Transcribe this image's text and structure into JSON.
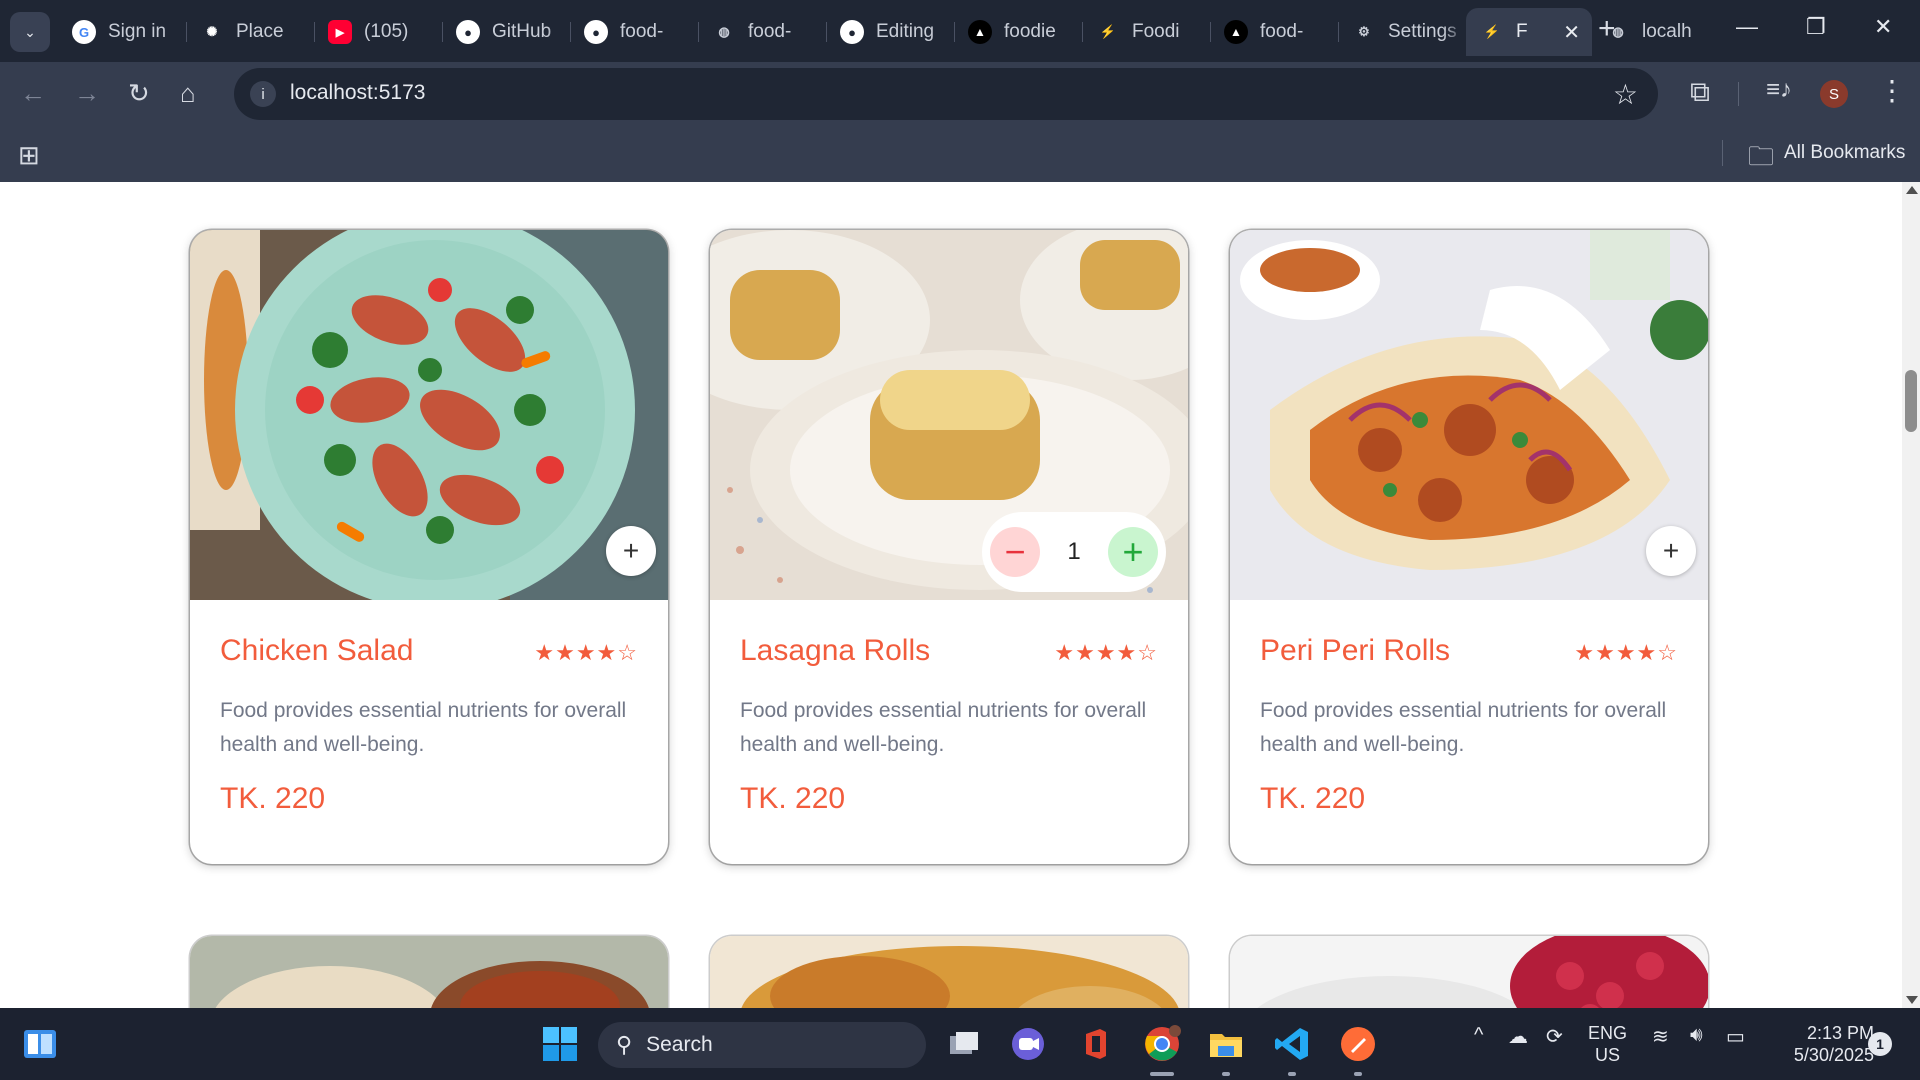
{
  "browser": {
    "tabs": [
      {
        "title": "Sign in",
        "favicon": "google-icon",
        "color": "#ffffff"
      },
      {
        "title": "Place",
        "favicon": "chatgpt-icon",
        "color": "#ffffff"
      },
      {
        "title": "(105)",
        "favicon": "youtube-icon",
        "color": "#ff0033"
      },
      {
        "title": "GitHub",
        "favicon": "github-icon",
        "color": "#ffffff"
      },
      {
        "title": "food-",
        "favicon": "github-icon",
        "color": "#ffffff"
      },
      {
        "title": "food-",
        "favicon": "globe-icon",
        "color": "#c9ced8"
      },
      {
        "title": "Editing",
        "favicon": "github-icon",
        "color": "#ffffff"
      },
      {
        "title": "foodie",
        "favicon": "vercel-icon",
        "color": "#ffffff"
      },
      {
        "title": "Foodi",
        "favicon": "vite-icon",
        "color": "#b67cff"
      },
      {
        "title": "food-",
        "favicon": "vercel-icon",
        "color": "#ffffff"
      },
      {
        "title": "Settings",
        "favicon": "gear-icon",
        "color": "#c9ced8"
      },
      {
        "title": "F",
        "favicon": "vite-icon",
        "color": "#b67cff",
        "active": true
      },
      {
        "title": "localh",
        "favicon": "globe-icon",
        "color": "#c9ced8"
      }
    ],
    "url": "localhost:5173",
    "bookmarks_label": "All Bookmarks",
    "profile_initial": "S"
  },
  "products": [
    {
      "name": "Chicken Salad",
      "rating": 4,
      "stars": "★★★★☆",
      "description": "Food provides essential nutrients for overall health and well-being.",
      "price": "TK. 220",
      "in_cart": 0
    },
    {
      "name": "Lasagna Rolls",
      "rating": 4,
      "stars": "★★★★☆",
      "description": "Food provides essential nutrients for overall health and well-being.",
      "price": "TK. 220",
      "in_cart": 1,
      "count": "1"
    },
    {
      "name": "Peri Peri Rolls",
      "rating": 4,
      "stars": "★★★★☆",
      "description": "Food provides essential nutrients for overall health and well-being.",
      "price": "TK. 220",
      "in_cart": 0
    }
  ],
  "theme": {
    "accent": "#f25c3c",
    "text_muted": "#727888",
    "minus_bg": "#ffd5d5",
    "plus_bg": "#c9f5cf"
  },
  "taskbar": {
    "search_label": "Search",
    "lang_line1": "ENG",
    "lang_line2": "US",
    "time": "2:13 PM",
    "date": "5/30/2025",
    "notifications": "1"
  }
}
